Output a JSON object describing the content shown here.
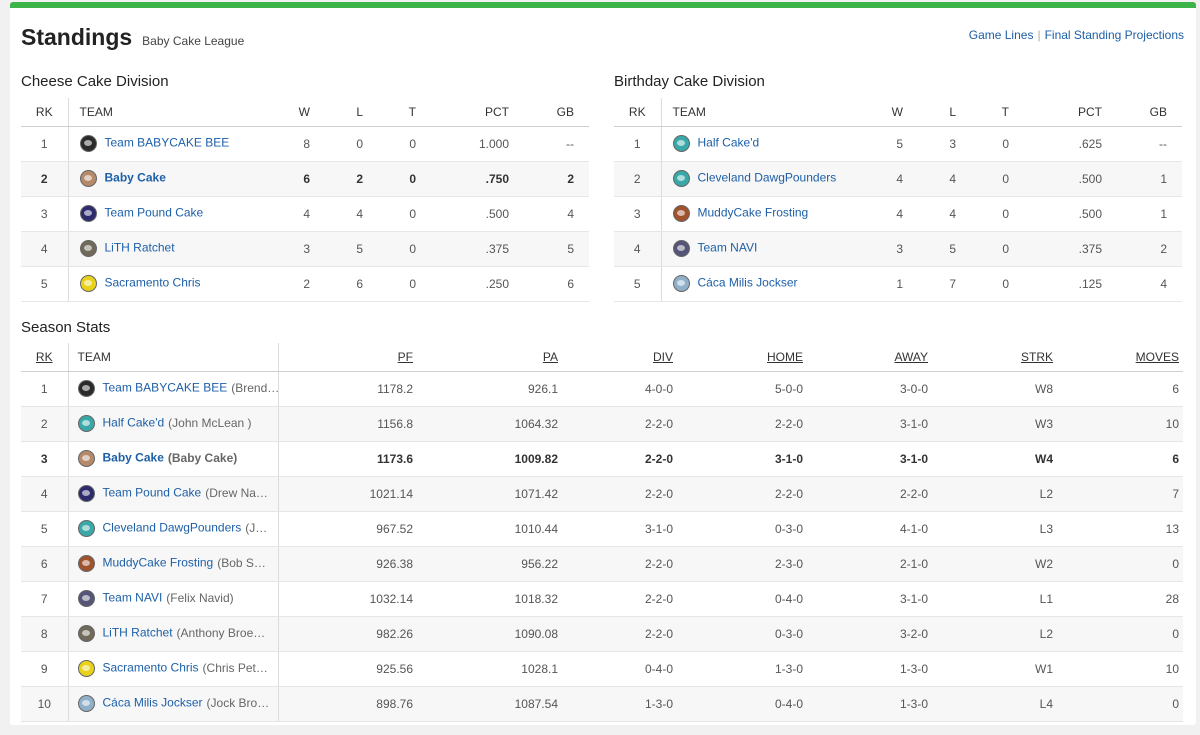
{
  "header": {
    "title": "Standings",
    "league": "Baby Cake League"
  },
  "links": {
    "game_lines": "Game Lines",
    "sep": "|",
    "projections": "Final Standing Projections"
  },
  "div_headers": {
    "rk": "RK",
    "team": "TEAM",
    "w": "W",
    "l": "L",
    "t": "T",
    "pct": "PCT",
    "gb": "GB"
  },
  "divisions": [
    {
      "name": "Cheese Cake Division",
      "rows": [
        {
          "rk": "1",
          "team": "Team BABYCAKE BEE",
          "w": "8",
          "l": "0",
          "t": "0",
          "pct": "1.000",
          "gb": "--",
          "logo_color": "#2b2b2b",
          "logo_icon": "bee-helmet-icon"
        },
        {
          "rk": "2",
          "team": "Baby Cake",
          "w": "6",
          "l": "2",
          "t": "0",
          "pct": ".750",
          "gb": "2",
          "logo_color": "#b48a6a",
          "logo_icon": "bunny-icon",
          "me": true
        },
        {
          "rk": "3",
          "team": "Team Pound Cake",
          "w": "4",
          "l": "4",
          "t": "0",
          "pct": ".500",
          "gb": "4",
          "logo_color": "#2e2a6e",
          "logo_icon": "helmet-icon"
        },
        {
          "rk": "4",
          "team": "LiTH Ratchet",
          "w": "3",
          "l": "5",
          "t": "0",
          "pct": ".375",
          "gb": "5",
          "logo_color": "#6f6a5a",
          "logo_icon": "raccoon-icon"
        },
        {
          "rk": "5",
          "team": "Sacramento Chris",
          "w": "2",
          "l": "6",
          "t": "0",
          "pct": ".250",
          "gb": "6",
          "logo_color": "#e8d21a",
          "logo_icon": "helmet-icon"
        }
      ]
    },
    {
      "name": "Birthday Cake Division",
      "rows": [
        {
          "rk": "1",
          "team": "Half Cake'd",
          "w": "5",
          "l": "3",
          "t": "0",
          "pct": ".625",
          "gb": "--",
          "logo_color": "#3aa8a8",
          "logo_icon": "helmet-icon"
        },
        {
          "rk": "2",
          "team": "Cleveland DawgPounders",
          "w": "4",
          "l": "4",
          "t": "0",
          "pct": ".500",
          "gb": "1",
          "logo_color": "#3aa8a8",
          "logo_icon": "helmet-icon"
        },
        {
          "rk": "3",
          "team": "MuddyCake Frosting",
          "w": "4",
          "l": "4",
          "t": "0",
          "pct": ".500",
          "gb": "1",
          "logo_color": "#a0522d",
          "logo_icon": "cake-icon"
        },
        {
          "rk": "4",
          "team": "Team NAVI",
          "w": "3",
          "l": "5",
          "t": "0",
          "pct": ".375",
          "gb": "2",
          "logo_color": "#555577",
          "logo_icon": "badge-icon"
        },
        {
          "rk": "5",
          "team": "Cáca Milis Jockser",
          "w": "1",
          "l": "7",
          "t": "0",
          "pct": ".125",
          "gb": "4",
          "logo_color": "#8fb0c8",
          "logo_icon": "ball-icon"
        }
      ]
    }
  ],
  "season": {
    "title": "Season Stats",
    "headers": {
      "rk": "RK",
      "team": "TEAM",
      "pf": "PF",
      "pa": "PA",
      "div": "DIV",
      "home": "HOME",
      "away": "AWAY",
      "strk": "STRK",
      "moves": "MOVES"
    },
    "rows": [
      {
        "rk": "1",
        "team": "Team BABYCAKE BEE",
        "owner": "(Brend…",
        "pf": "1178.2",
        "pa": "926.1",
        "div": "4-0-0",
        "home": "5-0-0",
        "away": "3-0-0",
        "strk": "W8",
        "moves": "6",
        "logo_color": "#2b2b2b",
        "logo_icon": "bee-helmet-icon"
      },
      {
        "rk": "2",
        "team": "Half Cake'd",
        "owner": "(John McLean )",
        "pf": "1156.8",
        "pa": "1064.32",
        "div": "2-2-0",
        "home": "2-2-0",
        "away": "3-1-0",
        "strk": "W3",
        "moves": "10",
        "logo_color": "#3aa8a8",
        "logo_icon": "helmet-icon"
      },
      {
        "rk": "3",
        "team": "Baby Cake",
        "owner": "(Baby Cake)",
        "pf": "1173.6",
        "pa": "1009.82",
        "div": "2-2-0",
        "home": "3-1-0",
        "away": "3-1-0",
        "strk": "W4",
        "moves": "6",
        "logo_color": "#b48a6a",
        "logo_icon": "bunny-icon",
        "me": true
      },
      {
        "rk": "4",
        "team": "Team Pound Cake",
        "owner": "(Drew Na…",
        "pf": "1021.14",
        "pa": "1071.42",
        "div": "2-2-0",
        "home": "2-2-0",
        "away": "2-2-0",
        "strk": "L2",
        "moves": "7",
        "logo_color": "#2e2a6e",
        "logo_icon": "helmet-icon"
      },
      {
        "rk": "5",
        "team": "Cleveland DawgPounders",
        "owner": "(J…",
        "pf": "967.52",
        "pa": "1010.44",
        "div": "3-1-0",
        "home": "0-3-0",
        "away": "4-1-0",
        "strk": "L3",
        "moves": "13",
        "logo_color": "#3aa8a8",
        "logo_icon": "helmet-icon"
      },
      {
        "rk": "6",
        "team": "MuddyCake Frosting",
        "owner": "(Bob S…",
        "pf": "926.38",
        "pa": "956.22",
        "div": "2-2-0",
        "home": "2-3-0",
        "away": "2-1-0",
        "strk": "W2",
        "moves": "0",
        "logo_color": "#a0522d",
        "logo_icon": "cake-icon"
      },
      {
        "rk": "7",
        "team": "Team NAVI",
        "owner": "(Felix Navid)",
        "pf": "1032.14",
        "pa": "1018.32",
        "div": "2-2-0",
        "home": "0-4-0",
        "away": "3-1-0",
        "strk": "L1",
        "moves": "28",
        "logo_color": "#555577",
        "logo_icon": "badge-icon"
      },
      {
        "rk": "8",
        "team": "LiTH Ratchet",
        "owner": "(Anthony Broe…",
        "pf": "982.26",
        "pa": "1090.08",
        "div": "2-2-0",
        "home": "0-3-0",
        "away": "3-2-0",
        "strk": "L2",
        "moves": "0",
        "logo_color": "#6f6a5a",
        "logo_icon": "raccoon-icon"
      },
      {
        "rk": "9",
        "team": "Sacramento Chris",
        "owner": "(Chris Pet…",
        "pf": "925.56",
        "pa": "1028.1",
        "div": "0-4-0",
        "home": "1-3-0",
        "away": "1-3-0",
        "strk": "W1",
        "moves": "10",
        "logo_color": "#e8d21a",
        "logo_icon": "helmet-icon"
      },
      {
        "rk": "10",
        "team": "Cáca Milis Jockser",
        "owner": "(Jock Bro…",
        "pf": "898.76",
        "pa": "1087.54",
        "div": "1-3-0",
        "home": "0-4-0",
        "away": "1-3-0",
        "strk": "L4",
        "moves": "0",
        "logo_color": "#8fb0c8",
        "logo_icon": "ball-icon"
      }
    ]
  }
}
